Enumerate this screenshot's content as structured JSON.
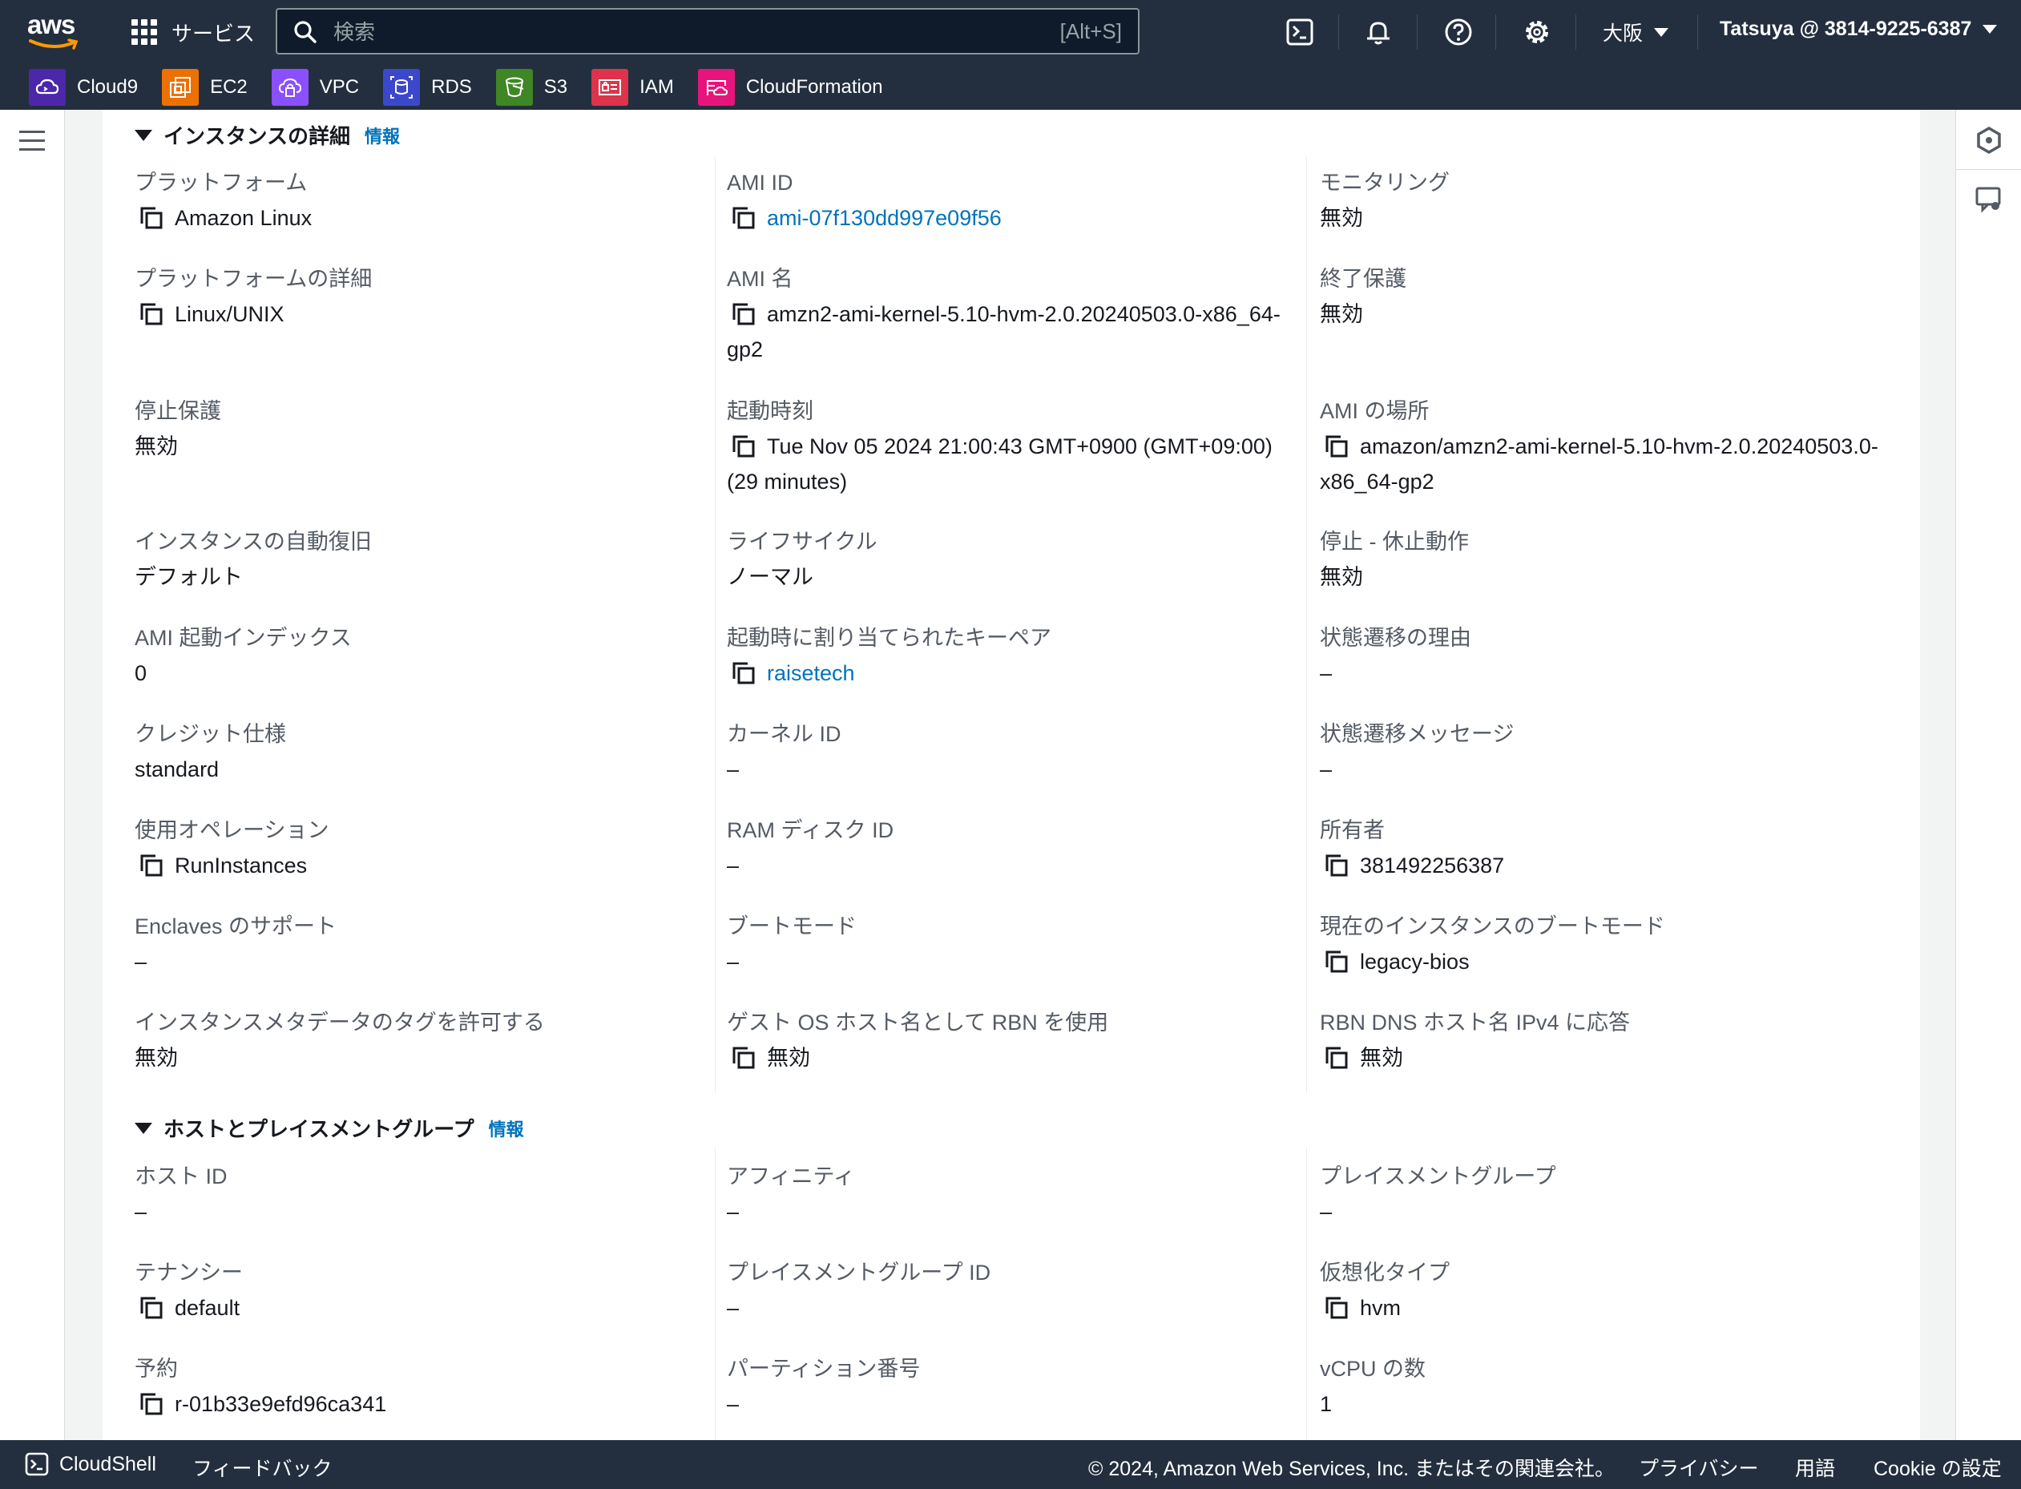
{
  "nav": {
    "logo_text": "aws",
    "services_label": "サービス",
    "search_placeholder": "検索",
    "search_hint": "[Alt+S]",
    "region": "大阪",
    "account": "Tatsuya @ 3814-9225-6387"
  },
  "favorites": [
    {
      "label": "Cloud9",
      "icon": "cloud9-icon",
      "color": "#4d27aa"
    },
    {
      "label": "EC2",
      "icon": "ec2-icon",
      "color": "#ed7100"
    },
    {
      "label": "VPC",
      "icon": "vpc-icon",
      "color": "#8c4fff"
    },
    {
      "label": "RDS",
      "icon": "rds-icon",
      "color": "#3b48cc"
    },
    {
      "label": "S3",
      "icon": "s3-icon",
      "color": "#3f8624"
    },
    {
      "label": "IAM",
      "icon": "iam-icon",
      "color": "#dd344c"
    },
    {
      "label": "CloudFormation",
      "icon": "cloudformation-icon",
      "color": "#e7157b"
    }
  ],
  "sections": {
    "instance_details": {
      "title": "インスタンスの詳細",
      "info": "情報"
    },
    "host_placement": {
      "title": "ホストとプレイスメントグループ",
      "info": "情報"
    }
  },
  "fields": {
    "platform": {
      "label": "プラットフォーム",
      "value": "Amazon Linux"
    },
    "ami_id": {
      "label": "AMI ID",
      "value": "ami-07f130dd997e09f56"
    },
    "monitoring": {
      "label": "モニタリング",
      "value": "無効"
    },
    "platform_details": {
      "label": "プラットフォームの詳細",
      "value": "Linux/UNIX"
    },
    "ami_name": {
      "label": "AMI 名",
      "value": "amzn2-ami-kernel-5.10-hvm-2.0.20240503.0-x86_64-gp2"
    },
    "termination_protection": {
      "label": "終了保護",
      "value": "無効"
    },
    "stop_protection": {
      "label": "停止保護",
      "value": "無効"
    },
    "launch_time": {
      "label": "起動時刻",
      "value": "Tue Nov 05 2024 21:00:43 GMT+0900 (GMT+09:00) (29 minutes)"
    },
    "ami_location": {
      "label": "AMI の場所",
      "value": "amazon/amzn2-ami-kernel-5.10-hvm-2.0.20240503.0-x86_64-gp2"
    },
    "auto_recovery": {
      "label": "インスタンスの自動復旧",
      "value": "デフォルト"
    },
    "lifecycle": {
      "label": "ライフサイクル",
      "value": "ノーマル"
    },
    "stop_hibernate": {
      "label": "停止 - 休止動作",
      "value": "無効"
    },
    "ami_launch_index": {
      "label": "AMI 起動インデックス",
      "value": "0"
    },
    "key_pair": {
      "label": "起動時に割り当てられたキーペア",
      "value": "raisetech"
    },
    "state_reason": {
      "label": "状態遷移の理由",
      "value": "–"
    },
    "credit_spec": {
      "label": "クレジット仕様",
      "value": "standard"
    },
    "kernel_id": {
      "label": "カーネル ID",
      "value": "–"
    },
    "state_message": {
      "label": "状態遷移メッセージ",
      "value": "–"
    },
    "usage_operation": {
      "label": "使用オペレーション",
      "value": "RunInstances"
    },
    "ramdisk_id": {
      "label": "RAM ディスク ID",
      "value": "–"
    },
    "owner": {
      "label": "所有者",
      "value": "381492256387"
    },
    "enclaves": {
      "label": "Enclaves のサポート",
      "value": "–"
    },
    "boot_mode": {
      "label": "ブートモード",
      "value": "–"
    },
    "current_boot_mode": {
      "label": "現在のインスタンスのブートモード",
      "value": "legacy-bios"
    },
    "metadata_tags": {
      "label": "インスタンスメタデータのタグを許可する",
      "value": "無効"
    },
    "rbn_hostname": {
      "label": "ゲスト OS ホスト名として RBN を使用",
      "value": "無効"
    },
    "rbn_dns_ipv4": {
      "label": "RBN DNS ホスト名 IPv4 に応答",
      "value": "無効"
    },
    "host_id": {
      "label": "ホスト ID",
      "value": "–"
    },
    "affinity": {
      "label": "アフィニティ",
      "value": "–"
    },
    "placement_group": {
      "label": "プレイスメントグループ",
      "value": "–"
    },
    "tenancy": {
      "label": "テナンシー",
      "value": "default"
    },
    "placement_group_id": {
      "label": "プレイスメントグループ ID",
      "value": "–"
    },
    "virtualization_type": {
      "label": "仮想化タイプ",
      "value": "hvm"
    },
    "reservation": {
      "label": "予約",
      "value": "r-01b33e9efd96ca341"
    },
    "partition_number": {
      "label": "パーティション番号",
      "value": "–"
    },
    "vcpu_count": {
      "label": "vCPU の数",
      "value": "1"
    }
  },
  "footer": {
    "cloudshell": "CloudShell",
    "feedback": "フィードバック",
    "copyright": "© 2024, Amazon Web Services, Inc. またはその関連会社。",
    "privacy": "プライバシー",
    "terms": "用語",
    "cookie": "Cookie の設定"
  }
}
